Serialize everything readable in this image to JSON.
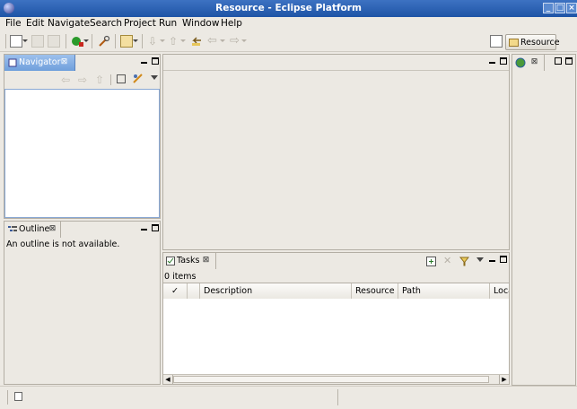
{
  "window": {
    "title": "Resource - Eclipse Platform"
  },
  "menu": [
    "File",
    "Edit",
    "Navigate",
    "Search",
    "Project",
    "Run",
    "Window",
    "Help"
  ],
  "perspective": {
    "label": "Resource"
  },
  "navigator": {
    "tab_label": "Navigator"
  },
  "outline": {
    "tab_label": "Outline",
    "message": "An outline is not available."
  },
  "tasks": {
    "tab_label": "Tasks",
    "count": "0 items",
    "columns": [
      "✓",
      "",
      "Description",
      "Resource",
      "Path",
      "Loca"
    ]
  },
  "colors": {
    "title_bar": "#2a5fb2",
    "active_tab": "#7fa9df",
    "window_bg": "#ece9e3"
  },
  "icons": [
    "eclipse-app-icon",
    "new-wizard-icon",
    "save-icon",
    "print-icon",
    "run-icon",
    "search-icon",
    "open-perspective-icon",
    "next-annotation-icon",
    "previous-annotation-icon",
    "last-edit-icon",
    "back-icon",
    "forward-icon"
  ]
}
